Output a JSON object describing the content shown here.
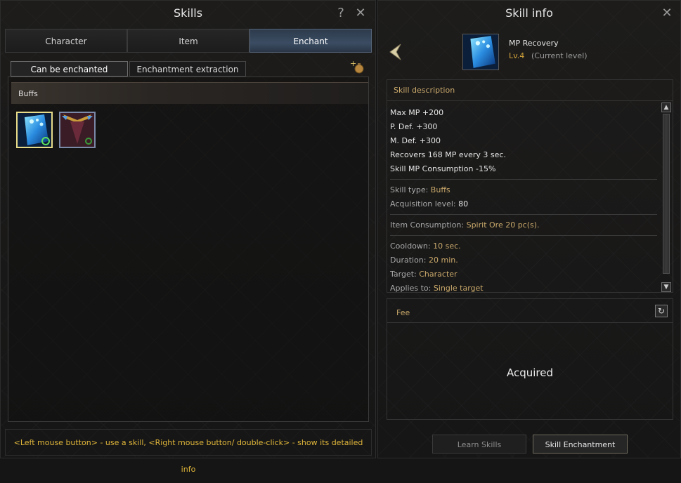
{
  "skills_window": {
    "title": "Skills",
    "help_icon": "question-icon",
    "close_icon": "close-icon",
    "main_tabs": [
      {
        "label": "Character",
        "active": false
      },
      {
        "label": "Item",
        "active": false
      },
      {
        "label": "Enchant",
        "active": true
      }
    ],
    "sub_tabs": [
      {
        "label": "Can be enchanted",
        "active": true
      },
      {
        "label": "Enchantment extraction",
        "active": false
      }
    ],
    "section_title": "Buffs",
    "skills": [
      {
        "name": "MP Recovery",
        "icon": "mp-recovery-skill-icon",
        "selected": true
      },
      {
        "name": "Buff skill",
        "icon": "shield-buff-skill-icon",
        "selected": false
      }
    ],
    "hint": "<Left mouse button> - use a skill, <Right mouse button/ double-click> - show its detailed info"
  },
  "skill_info": {
    "title": "Skill info",
    "close_icon": "close-icon",
    "skill_name": "MP Recovery",
    "level": "Lv.4",
    "level_note": "(Current level)",
    "description_header": "Skill description",
    "effects": [
      "Max MP +200",
      "P. Def. +300",
      "M. Def. +300",
      "Recovers 168 MP every 3 sec.",
      "Skill MP Consumption -15%"
    ],
    "skill_type_label": "Skill type: ",
    "skill_type": "Buffs",
    "acquisition_level_label": "Acquisition level: ",
    "acquisition_level": "80",
    "item_consumption_label": "Item Consumption: ",
    "item_consumption": "Spirit Ore 20 pc(s).",
    "cooldown_label": "Cooldown: ",
    "cooldown": "10 sec.",
    "duration_label": "Duration: ",
    "duration": "20 min.",
    "target_label": "Target: ",
    "target": "Character",
    "applies_to_label": "Applies to: ",
    "applies_to": "Single target",
    "fee_header": "Fee",
    "fee_status": "Acquired",
    "learn_button": "Learn Skills",
    "enchant_button": "Skill Enchantment"
  },
  "colors": {
    "accent_gold": "#c9a86a",
    "hint_yellow": "#e0b63a",
    "active_tab_blue": "#3b4d63"
  }
}
